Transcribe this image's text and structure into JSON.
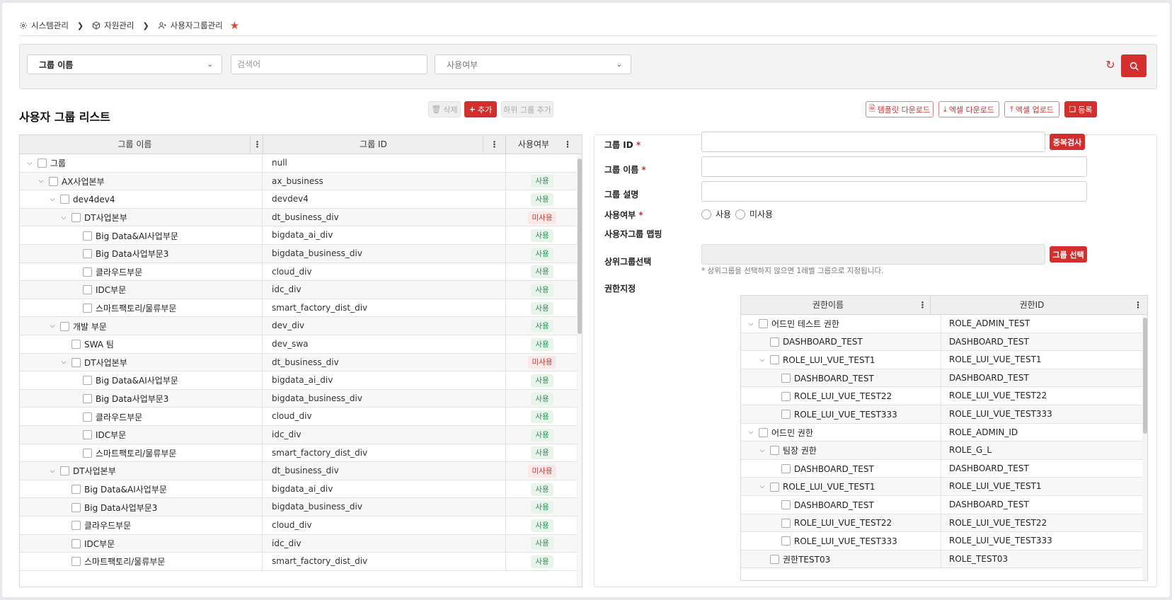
{
  "breadcrumb": {
    "items": [
      {
        "label": "시스템관리",
        "icon": "gear-icon"
      },
      {
        "label": "자원관리",
        "icon": "cube-icon"
      },
      {
        "label": "사용자그룹관리",
        "icon": "users-icon"
      }
    ],
    "favorite": "star-icon"
  },
  "search": {
    "field_select": "그룹 이름",
    "keyword_placeholder": "검색어",
    "use_select_placeholder": "사용여부"
  },
  "list": {
    "title": "사용자 그룹 리스트",
    "delete_label": "삭제",
    "add_label": "추가",
    "add_sub_label": "하위 그룹 추가",
    "columns": [
      "그룹 이름",
      "그룹 ID",
      "사용여부"
    ],
    "rows": [
      {
        "name": "그룹",
        "id": "null",
        "status": "",
        "toggle": "open"
      },
      {
        "name": "AX사업본부",
        "id": "ax_business",
        "status": "사용",
        "toggle": "open"
      },
      {
        "name": "dev4dev4",
        "id": "devdev4",
        "status": "사용",
        "toggle": "open"
      },
      {
        "name": "DT사업본부",
        "id": "dt_business_div",
        "status": "미사용",
        "toggle": "open"
      },
      {
        "name": "Big Data&AI사업부문",
        "id": "bigdata_ai_div",
        "status": "사용",
        "toggle": ""
      },
      {
        "name": "Big Data사업부문3",
        "id": "bigdata_business_div",
        "status": "사용",
        "toggle": ""
      },
      {
        "name": "클라우드부문",
        "id": "cloud_div",
        "status": "사용",
        "toggle": ""
      },
      {
        "name": "IDC부문",
        "id": "idc_div",
        "status": "사용",
        "toggle": ""
      },
      {
        "name": "스마트팩토리/물류부문",
        "id": "smart_factory_dist_div",
        "status": "사용",
        "toggle": ""
      },
      {
        "name": "개발 부문",
        "id": "dev_div",
        "status": "사용",
        "toggle": "open"
      },
      {
        "name": "SWA 팀",
        "id": "dev_swa",
        "status": "사용",
        "toggle": ""
      },
      {
        "name": "DT사업본부",
        "id": "dt_business_div",
        "status": "미사용",
        "toggle": "open"
      },
      {
        "name": "Big Data&AI사업부문",
        "id": "bigdata_ai_div",
        "status": "사용",
        "toggle": ""
      },
      {
        "name": "Big Data사업부문3",
        "id": "bigdata_business_div",
        "status": "사용",
        "toggle": ""
      },
      {
        "name": "클라우드부문",
        "id": "cloud_div",
        "status": "사용",
        "toggle": ""
      },
      {
        "name": "IDC부문",
        "id": "idc_div",
        "status": "사용",
        "toggle": ""
      },
      {
        "name": "스마트팩토리/물류부문",
        "id": "smart_factory_dist_div",
        "status": "사용",
        "toggle": ""
      },
      {
        "name": "DT사업본부",
        "id": "dt_business_div",
        "status": "미사용",
        "toggle": "open"
      },
      {
        "name": "Big Data&AI사업부문",
        "id": "bigdata_ai_div",
        "status": "사용",
        "toggle": ""
      },
      {
        "name": "Big Data사업부문3",
        "id": "bigdata_business_div",
        "status": "사용",
        "toggle": ""
      },
      {
        "name": "클라우드부문",
        "id": "cloud_div",
        "status": "사용",
        "toggle": ""
      },
      {
        "name": "IDC부문",
        "id": "idc_div",
        "status": "사용",
        "toggle": ""
      },
      {
        "name": "스마트팩토리/물류부문",
        "id": "smart_factory_dist_div",
        "status": "사용",
        "toggle": ""
      }
    ]
  },
  "toolbar": {
    "template_download": "템플릿 다운로드",
    "excel_download": "엑셀 다운로드",
    "excel_upload": "엑셀 업로드",
    "register": "등록"
  },
  "form": {
    "group_id_label": "그룹 ID",
    "dup_check": "중복검사",
    "group_name_label": "그룹 이름",
    "group_desc_label": "그룹 설명",
    "use_label": "사용여부",
    "use_option": "사용",
    "nouse_option": "미사용",
    "mapping_label": "사용자그룹 맵핑",
    "parent_label": "상위그룹선택",
    "group_select": "그룹 선택",
    "parent_hint": "* 상위그룹을 선택하지 않으면 1레벨 그룹으로 지정됩니다.",
    "perm_label": "권한지정",
    "perm_columns": [
      "권한이름",
      "권한ID"
    ],
    "perm_rows": [
      {
        "name": "어드민 테스트 권한",
        "id": "ROLE_ADMIN_TEST",
        "toggle": "open"
      },
      {
        "name": "DASHBOARD_TEST",
        "id": "DASHBOARD_TEST",
        "toggle": ""
      },
      {
        "name": "ROLE_LUI_VUE_TEST1",
        "id": "ROLE_LUI_VUE_TEST1",
        "toggle": "open"
      },
      {
        "name": "DASHBOARD_TEST",
        "id": "DASHBOARD_TEST",
        "toggle": ""
      },
      {
        "name": "ROLE_LUI_VUE_TEST22",
        "id": "ROLE_LUI_VUE_TEST22",
        "toggle": ""
      },
      {
        "name": "ROLE_LUI_VUE_TEST333",
        "id": "ROLE_LUI_VUE_TEST333",
        "toggle": ""
      },
      {
        "name": "어드민 권한",
        "id": "ROLE_ADMIN_ID",
        "toggle": "open"
      },
      {
        "name": "팀장 권한",
        "id": "ROLE_G_L",
        "toggle": "open"
      },
      {
        "name": "DASHBOARD_TEST",
        "id": "DASHBOARD_TEST",
        "toggle": ""
      },
      {
        "name": "ROLE_LUI_VUE_TEST1",
        "id": "ROLE_LUI_VUE_TEST1",
        "toggle": "open"
      },
      {
        "name": "DASHBOARD_TEST",
        "id": "DASHBOARD_TEST",
        "toggle": ""
      },
      {
        "name": "ROLE_LUI_VUE_TEST22",
        "id": "ROLE_LUI_VUE_TEST22",
        "toggle": ""
      },
      {
        "name": "ROLE_LUI_VUE_TEST333",
        "id": "ROLE_LUI_VUE_TEST333",
        "toggle": ""
      },
      {
        "name": "권한TEST03",
        "id": "ROLE_TEST03",
        "toggle": ""
      }
    ]
  },
  "colors": {
    "accent": "#d32f2f",
    "use_badge": "#2e8b57",
    "nouse_badge": "#d32f2f"
  }
}
